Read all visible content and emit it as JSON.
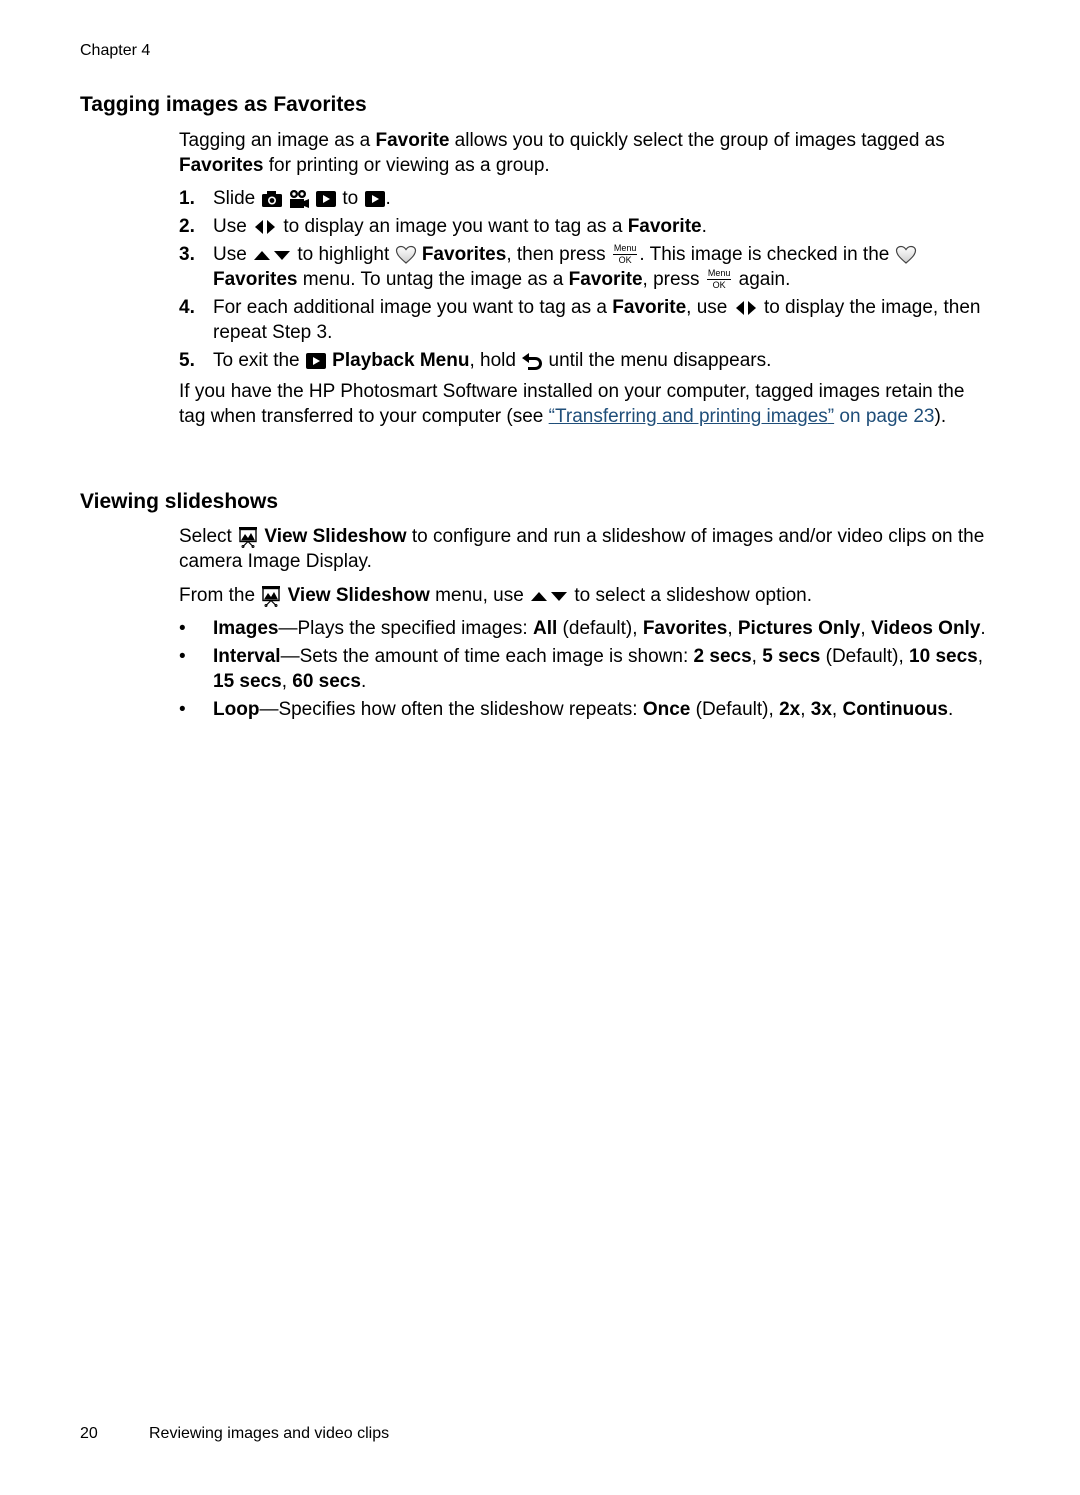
{
  "header": {
    "chapter": "Chapter 4"
  },
  "tagging": {
    "title": "Tagging images as Favorites",
    "intro": {
      "t1": "Tagging an image as a ",
      "b1": "Favorite",
      "t2": " allows you to quickly select the group of images tagged as ",
      "b2": "Favorites",
      "t3": " for printing or viewing as a group."
    },
    "steps": [
      {
        "num": "1.",
        "t1": "Slide ",
        "t2": " to ",
        "t3": "."
      },
      {
        "num": "2.",
        "t1": "Use ",
        "t2": " to display an image you want to tag as a ",
        "b1": "Favorite",
        "t3": "."
      },
      {
        "num": "3.",
        "t1": "Use ",
        "t2": " to highlight ",
        "b1": "Favorites",
        "t3": ", then press ",
        "t4": ". This image is checked in the ",
        "b2": "Favorites",
        "t5": " menu. To untag the image as a ",
        "b3": "Favorite",
        "t6": ", press ",
        "t7": " again."
      },
      {
        "num": "4.",
        "t1": "For each additional image you want to tag as a ",
        "b1": "Favorite",
        "t2": ", use ",
        "t3": " to display the image, then repeat Step 3."
      },
      {
        "num": "5.",
        "t1": "To exit the ",
        "b1": "Playback Menu",
        "t2": ", hold ",
        "t3": " until the menu disappears."
      }
    ],
    "note": {
      "t1": "If you have the HP Photosmart Software installed on your computer, tagged images retain the tag when transferred to your computer (see ",
      "link_open_quote": "“",
      "link": "Transferring and printing images",
      "link_close_quote": "”",
      "page_ref": " on page 23",
      "t2": ")."
    }
  },
  "menu_ok_button": {
    "top": "Menu",
    "bottom": "OK"
  },
  "slideshows": {
    "title": "Viewing slideshows",
    "p1": {
      "t1": "Select ",
      "b1": "View Slideshow",
      "t2": " to configure and run a slideshow of images and/or video clips on the camera Image Display."
    },
    "p2": {
      "t1": "From the ",
      "b1": "View Slideshow",
      "t2": " menu, use ",
      "t3": " to select a slideshow option."
    },
    "options": [
      {
        "bullet": "•",
        "name": "Images",
        "desc": "—Plays the specified images: ",
        "v1": "All",
        "s1": " (default), ",
        "v2": "Favorites",
        "s2": ", ",
        "v3": "Pictures Only",
        "s3": ", ",
        "v4": "Videos Only",
        "s4": "."
      },
      {
        "bullet": "•",
        "name": "Interval",
        "desc": "—Sets the amount of time each image is shown: ",
        "v1": "2 secs",
        "s1": ", ",
        "v2": "5 secs",
        "s2": " (Default), ",
        "v3": "10 secs",
        "s3": ", ",
        "v4": "15 secs",
        "s4": ", ",
        "v5": "60 secs",
        "s5": "."
      },
      {
        "bullet": "•",
        "name": "Loop",
        "desc": "—Specifies how often the slideshow repeats: ",
        "v1": "Once",
        "s1": " (Default), ",
        "v2": "2x",
        "s2": ", ",
        "v3": "3x",
        "s3": ", ",
        "v4": "Continuous",
        "s4": "."
      }
    ]
  },
  "icons": {
    "camera": "camera-icon",
    "video": "video-camera-icon",
    "playback": "playback-icon",
    "left_right": "left-right-arrows-icon",
    "up_down": "up-down-arrows-icon",
    "heart": "heart-icon",
    "back": "back-arrow-icon",
    "slideshow": "slideshow-icon"
  },
  "footer": {
    "page_number": "20",
    "section": "Reviewing images and video clips"
  }
}
